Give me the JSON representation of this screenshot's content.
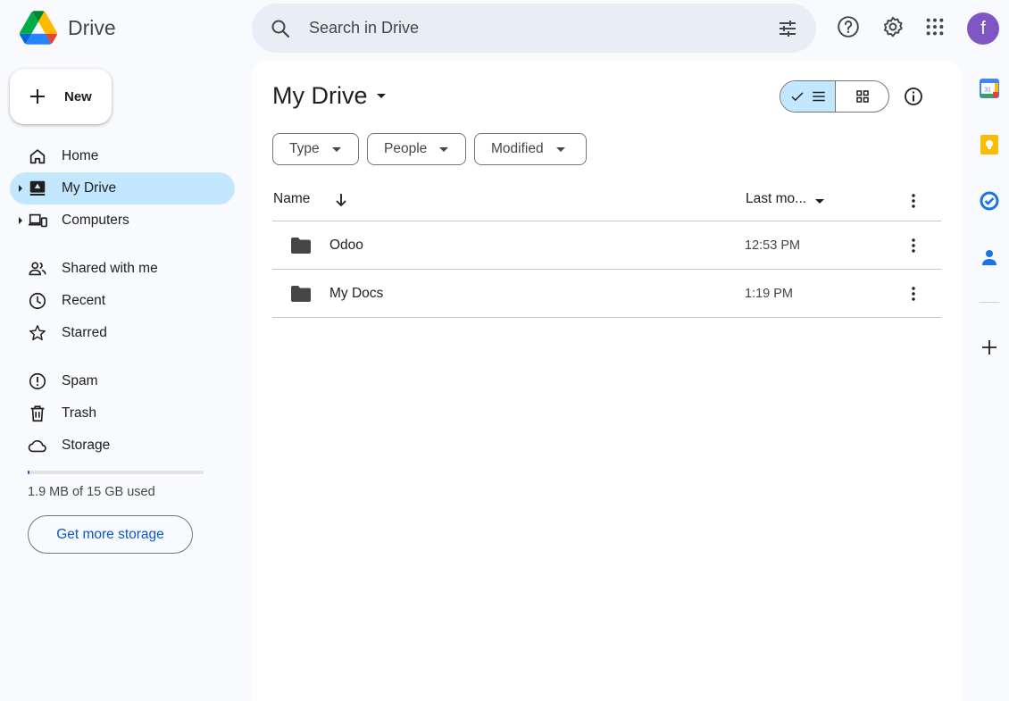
{
  "app": {
    "name": "Drive"
  },
  "search": {
    "placeholder": "Search in Drive"
  },
  "header": {
    "avatar_letter": "f",
    "avatar_color": "#7e57c2"
  },
  "new_button": {
    "label": "New"
  },
  "sidebar": {
    "items": [
      {
        "label": "Home",
        "icon": "home-icon"
      },
      {
        "label": "My Drive",
        "icon": "my-drive-icon",
        "active": true
      },
      {
        "label": "Computers",
        "icon": "computers-icon"
      },
      {
        "label": "Shared with me",
        "icon": "shared-icon"
      },
      {
        "label": "Recent",
        "icon": "clock-icon"
      },
      {
        "label": "Starred",
        "icon": "star-icon"
      },
      {
        "label": "Spam",
        "icon": "spam-icon"
      },
      {
        "label": "Trash",
        "icon": "trash-icon"
      },
      {
        "label": "Storage",
        "icon": "cloud-icon"
      }
    ],
    "storage_text": "1.9 MB of 15 GB used",
    "storage_fraction": 0.0001,
    "get_storage_label": "Get more storage"
  },
  "main": {
    "title": "My Drive",
    "filters": [
      "Type",
      "People",
      "Modified"
    ],
    "columns": {
      "name": "Name",
      "last_modified": "Last mo..."
    },
    "files": [
      {
        "name": "Odoo",
        "modified": "12:53 PM",
        "type": "folder"
      },
      {
        "name": "My Docs",
        "modified": "1:19 PM",
        "type": "folder"
      }
    ]
  },
  "colors": {
    "accent": "#0b57d0",
    "selected": "#c2e7ff",
    "background": "#f8fafd"
  }
}
